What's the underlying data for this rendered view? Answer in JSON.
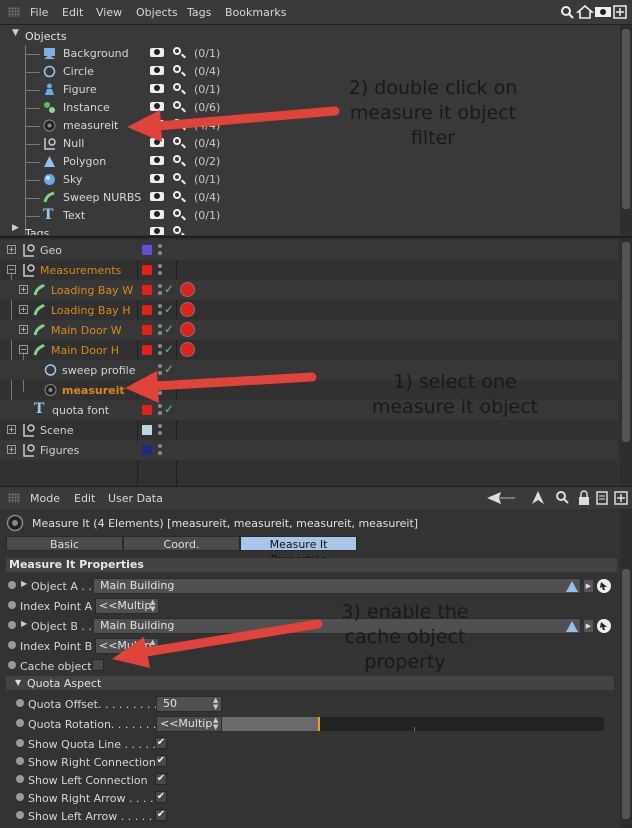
{
  "menubar": {
    "items": [
      "File",
      "Edit",
      "View",
      "Objects",
      "Tags",
      "Bookmarks"
    ]
  },
  "filter": {
    "root_label": "Objects",
    "items": [
      {
        "name": "Background",
        "count": "(0/1)",
        "icon": "background-icon"
      },
      {
        "name": "Circle",
        "count": "(0/4)",
        "icon": "circle-icon"
      },
      {
        "name": "Figure",
        "count": "(0/1)",
        "icon": "figure-icon"
      },
      {
        "name": "Instance",
        "count": "(0/6)",
        "icon": "instance-icon"
      },
      {
        "name": "measureit",
        "count": "(4/4)",
        "icon": "measureit-icon"
      },
      {
        "name": "Null",
        "count": "(0/4)",
        "icon": "null-icon"
      },
      {
        "name": "Polygon",
        "count": "(0/2)",
        "icon": "polygon-icon"
      },
      {
        "name": "Sky",
        "count": "(0/1)",
        "icon": "sky-icon"
      },
      {
        "name": "Sweep NURBS",
        "count": "(0/4)",
        "icon": "sweep-icon"
      },
      {
        "name": "Text",
        "count": "(0/1)",
        "icon": "text-icon"
      }
    ],
    "tags_label": "Tags"
  },
  "hierarchy": {
    "rows": [
      {
        "name": "Geo",
        "color": "#6a4bd6",
        "orange": false
      },
      {
        "name": "Measurements",
        "color": "#e0201a",
        "orange": true
      },
      {
        "name": "Loading Bay W",
        "color": "#e0201a",
        "orange": true
      },
      {
        "name": "Loading Bay H",
        "color": "#e0201a",
        "orange": true
      },
      {
        "name": "Main Door W",
        "color": "#e0201a",
        "orange": true
      },
      {
        "name": "Main Door H",
        "color": "#e0201a",
        "orange": true
      },
      {
        "name": "sweep profile",
        "color": "",
        "orange": false
      },
      {
        "name": "measureit",
        "color": "",
        "orange": true
      },
      {
        "name": "quota font",
        "color": "#e0201a",
        "orange": false
      },
      {
        "name": "Scene",
        "color": "#b8d8dc",
        "orange": false
      },
      {
        "name": "Figures",
        "color": "#1a2a8a",
        "orange": false
      }
    ]
  },
  "attributes": {
    "menu": [
      "Mode",
      "Edit",
      "User Data"
    ],
    "title": "Measure It (4 Elements) [measureit, measureit, measureit, measureit]",
    "tabs": [
      "Basic",
      "Coord.",
      "Measure It Properties"
    ],
    "section_title": "Measure It Properties",
    "props": {
      "object_a_label": "Object A . .",
      "object_a_value": "Main Building",
      "index_a_label": "Index Point A",
      "index_a_value": "<<Multip",
      "object_b_label": "Object B . .",
      "object_b_value": "Main Building",
      "index_b_label": "Index Point B",
      "index_b_value": "<<Multip",
      "cache_label": "Cache object",
      "quota_aspect_label": "Quota Aspect",
      "quota_offset_label": "Quota Offset. . . . . . . . .",
      "quota_offset_value": "50",
      "quota_rotation_label": "Quota Rotation. . . . . . .",
      "quota_rotation_value": "<<Multip",
      "show_quota_line": "Show Quota Line . . . . .",
      "show_right_connection": "Show Right Connection",
      "show_left_connection": "Show Left Connection",
      "show_right_arrow": "Show Right Arrow . . . .",
      "show_left_arrow": "Show Left Arrow . . . . ."
    }
  },
  "annotations": {
    "step2": "2) double click on\nmeasure it object\nfilter",
    "step1": "1) select one\nmeasure it object",
    "step3": "3) enable the\ncache object\nproperty"
  }
}
